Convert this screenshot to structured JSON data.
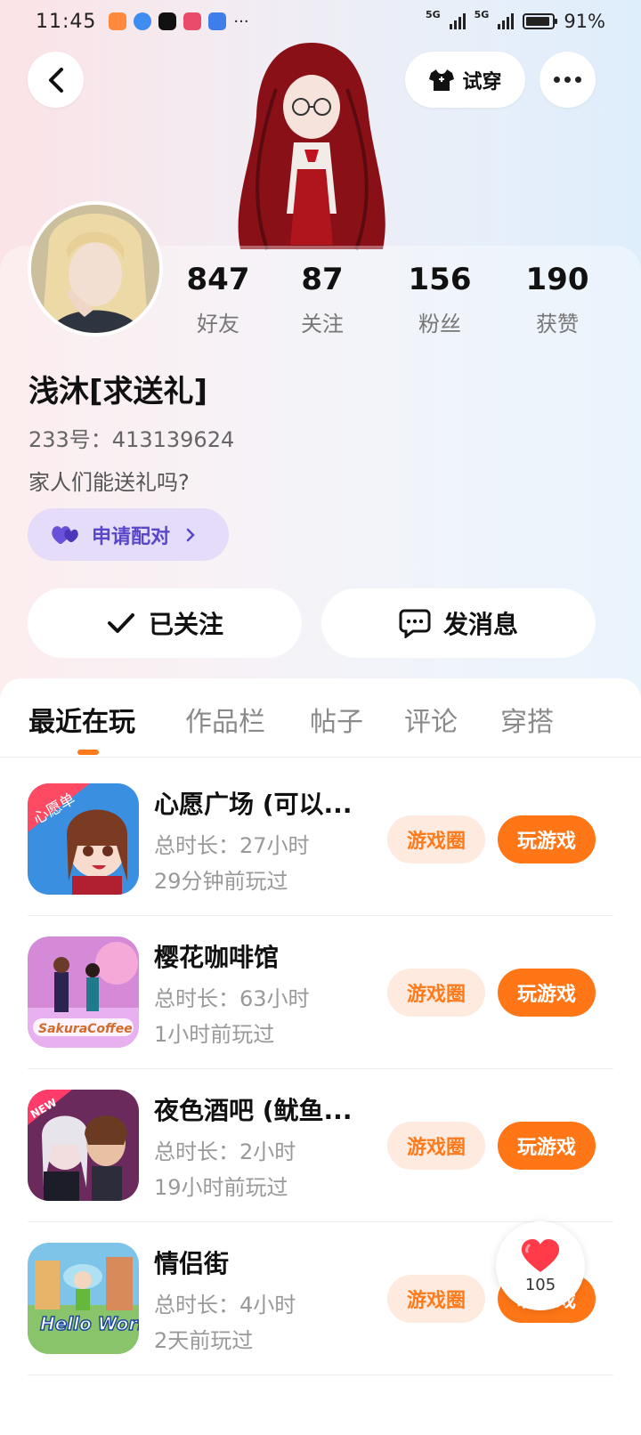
{
  "status_bar": {
    "time": "11:45",
    "more": "···",
    "network1": "5G",
    "network2": "5G",
    "battery_percent": "91%",
    "battery_level": 0.91
  },
  "header": {
    "try_on_label": "试穿"
  },
  "profile": {
    "stats": [
      {
        "value": "847",
        "label": "好友"
      },
      {
        "value": "87",
        "label": "关注"
      },
      {
        "value": "156",
        "label": "粉丝"
      },
      {
        "value": "190",
        "label": "获赞"
      }
    ],
    "nickname": "浅沐[求送礼]",
    "uid": "233号：413139624",
    "bio": "家人们能送礼吗?",
    "pair_label": "申请配对",
    "follow_label": "已关注",
    "message_label": "发消息"
  },
  "tabs": [
    "最近在玩",
    "作品栏",
    "帖子",
    "评论",
    "穿搭"
  ],
  "active_tab": "最近在玩",
  "games": [
    {
      "name": "心愿广场 (可以...",
      "duration": "总时长：27小时",
      "last_played": "29分钟前玩过",
      "circle_label": "游戏圈",
      "play_label": "玩游戏",
      "icon_text": "心愿单"
    },
    {
      "name": "樱花咖啡馆",
      "duration": "总时长：63小时",
      "last_played": "1小时前玩过",
      "circle_label": "游戏圈",
      "play_label": "玩游戏",
      "icon_text": "SakuraCoffee"
    },
    {
      "name": "夜色酒吧 (鱿鱼...",
      "duration": "总时长：2小时",
      "last_played": "19小时前玩过",
      "circle_label": "游戏圈",
      "play_label": "玩游戏",
      "icon_text": "NEW"
    },
    {
      "name": "情侣街",
      "duration": "总时长：4小时",
      "last_played": "2天前玩过",
      "circle_label": "游戏圈",
      "play_label": "玩游戏",
      "icon_text": "Hello World"
    }
  ],
  "like_float": {
    "count": "105"
  },
  "colors": {
    "accent_orange": "#ff7617",
    "pair_purple": "#5a46c8",
    "heart_red": "#ff3b4a"
  }
}
